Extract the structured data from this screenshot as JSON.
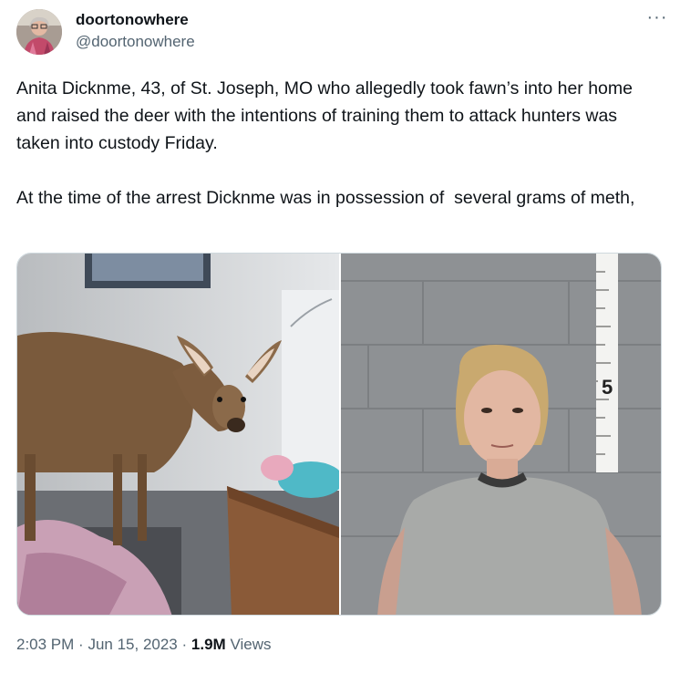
{
  "author": {
    "display_name": "doortonowhere",
    "handle": "@doortonowhere",
    "avatar_icon": "profile-avatar"
  },
  "more_icon": "more-horizontal-icon",
  "more_glyph": "···",
  "tweet_text": "Anita Dicknme, 43, of St. Joseph, MO who allegedly took fawn’s into her home and raised the deer with the intentions of training them to attack hunters was taken into custody Friday.\n\nAt the time of the arrest Dicknme was in possession of  several grams of meth,",
  "media": [
    {
      "name": "deer-photo",
      "subject": "deer indoors"
    },
    {
      "name": "mugshot-photo",
      "subject": "mugshot with height chart",
      "height_mark": "5"
    }
  ],
  "meta": {
    "time": "2:03 PM",
    "separator": "·",
    "date": "Jun 15, 2023",
    "views_count": "1.9M",
    "views_label": "Views"
  },
  "colors": {
    "text": "#0f1419",
    "secondary": "#536471",
    "border": "#cfd9de"
  }
}
